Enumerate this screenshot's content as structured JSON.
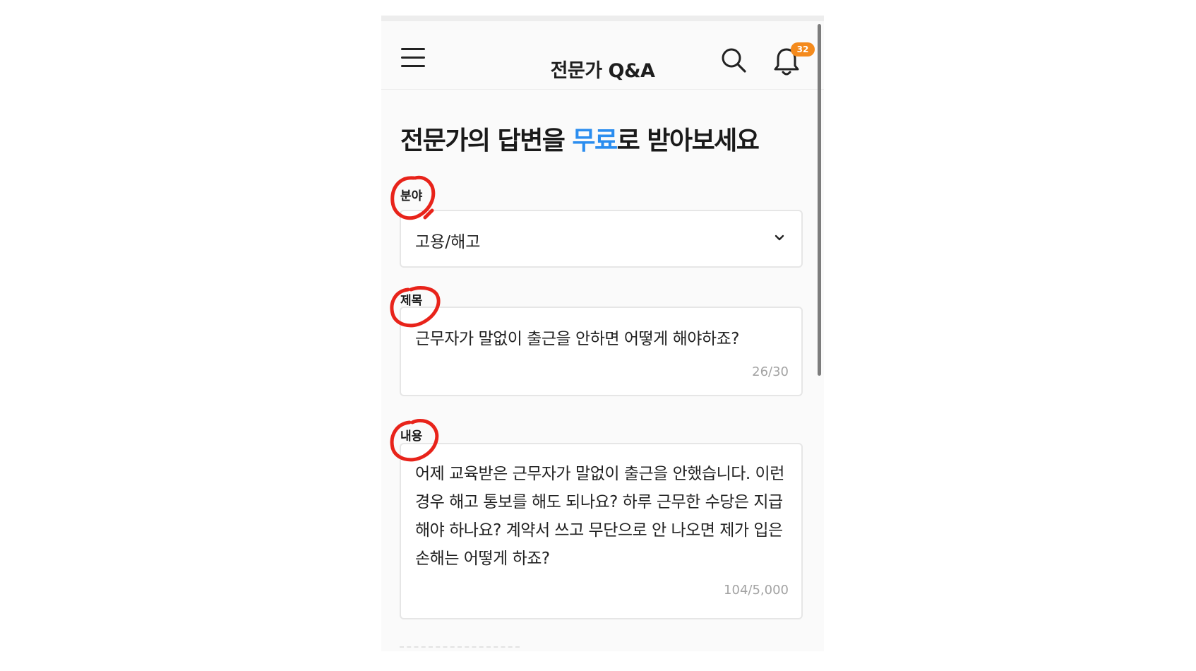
{
  "appbar": {
    "title": "전문가 Q&A",
    "notification_count": "32",
    "icons": [
      "menu-icon",
      "search-icon",
      "bell-icon"
    ]
  },
  "headline": {
    "part1": "전문가의 답변을 ",
    "accent": "무료",
    "part2": "로 받아보세요"
  },
  "form": {
    "category": {
      "label": "분야",
      "value": "고용/해고"
    },
    "title": {
      "label": "제목",
      "value": "근무자가 말없이 출근을 안하면 어떻게 해야하죠?",
      "counter": "26/30"
    },
    "content": {
      "label": "내용",
      "value": "어제 교육받은 근무자가 말없이 출근을 안했습니다. 이런 경우 해고 통보를 해도 되나요? 하루 근무한 수당은 지급해야 하나요? 계약서 쓰고 무단으로 안 나오면 제가 입은 손해는 어떻게 하죠?",
      "counter": "104/5,000"
    }
  },
  "colors": {
    "accent": "#2b8def",
    "badge": "#f48a1c",
    "annotation": "#e8231a"
  }
}
